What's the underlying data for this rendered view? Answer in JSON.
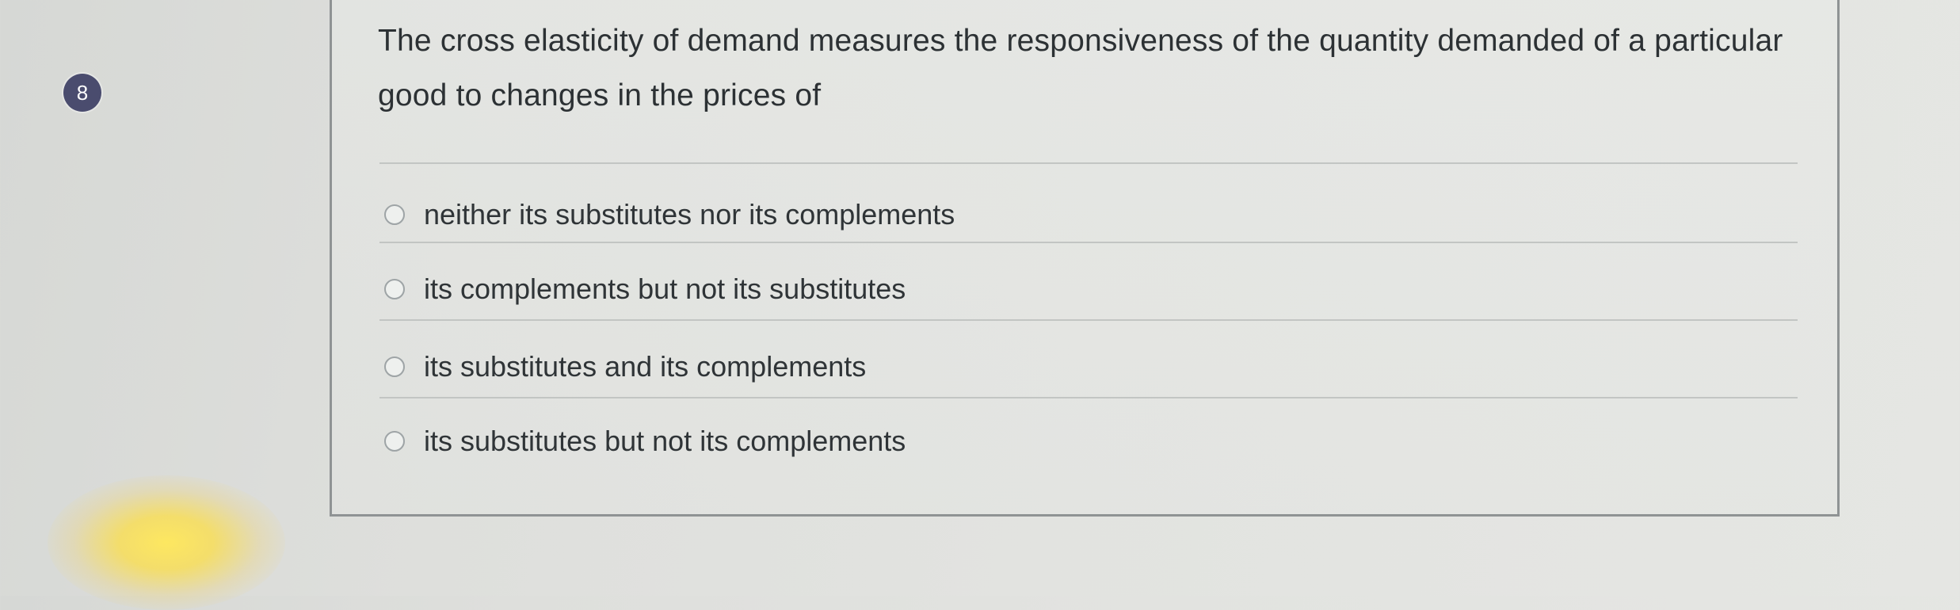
{
  "question": {
    "number": "8",
    "text": "The cross elasticity of demand measures the responsiveness of the quantity demanded of a particular good to changes in the prices of",
    "options": [
      {
        "label": "neither its substitutes nor its complements",
        "selected": false
      },
      {
        "label": "its complements but not its substitutes",
        "selected": false
      },
      {
        "label": "its substitutes and its complements",
        "selected": false
      },
      {
        "label": "its substitutes but not its complements",
        "selected": false
      }
    ]
  }
}
